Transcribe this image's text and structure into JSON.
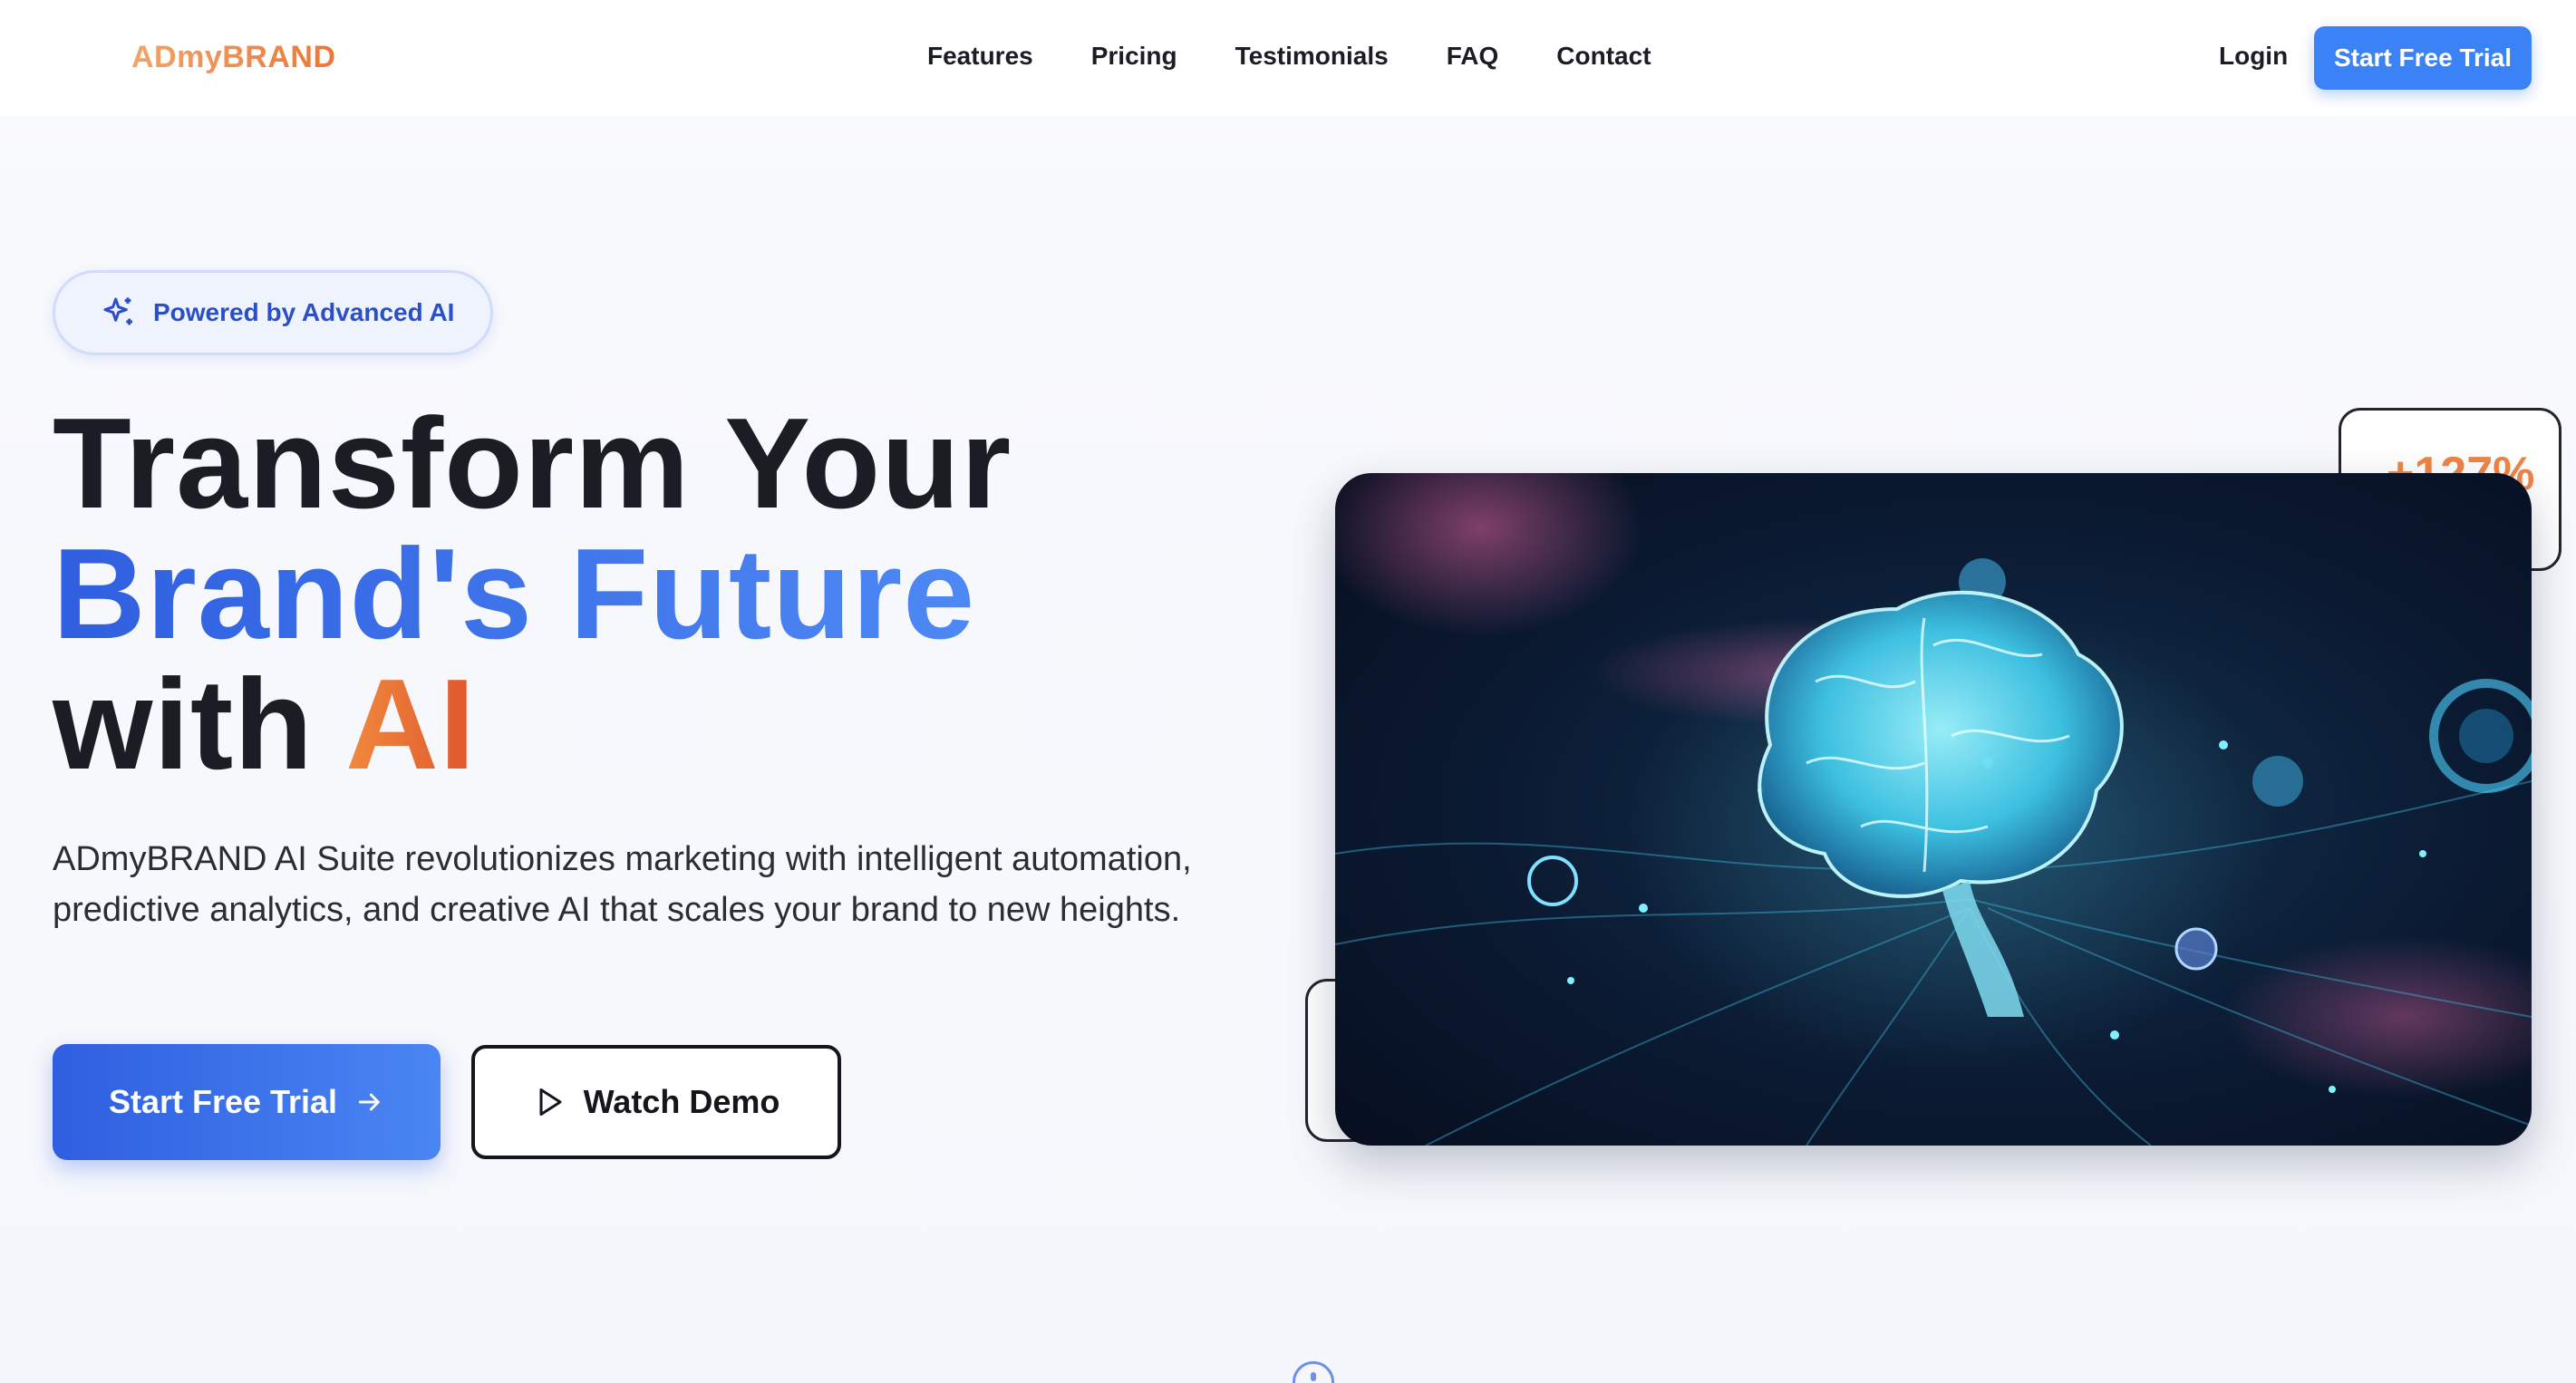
{
  "nav": {
    "logo": "ADmyBRAND",
    "links": [
      "Features",
      "Pricing",
      "Testimonials",
      "FAQ",
      "Contact"
    ],
    "login": "Login",
    "cta": "Start Free Trial"
  },
  "hero": {
    "badge": "Powered by Advanced AI",
    "headline_line1": "Transform Your",
    "headline_line2": "Brand's Future",
    "headline_line3_prefix": "with ",
    "headline_line3_highlight": "AI",
    "description": "ADmyBRAND AI Suite revolutionizes marketing with intelligent automation, predictive analytics, and creative AI that scales your brand to new heights.",
    "primary_button": "Start Free Trial",
    "secondary_button": "Watch Demo",
    "stat_value": "+127%",
    "image_icon": "glowing-brain-illustration"
  },
  "colors": {
    "accent_blue": "#3b82f6",
    "brand_orange": "#e8793a",
    "text_dark": "#1b1d24"
  }
}
